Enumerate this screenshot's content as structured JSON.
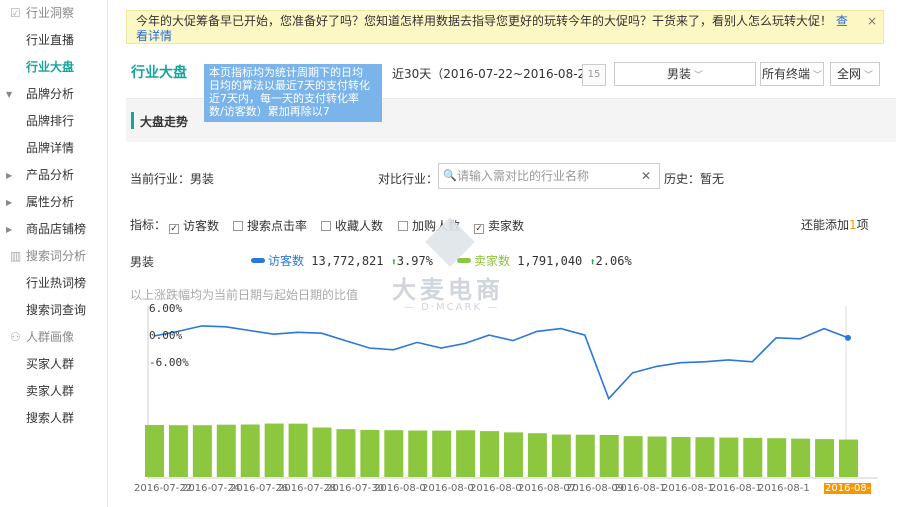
{
  "sidebar": {
    "groups": [
      {
        "icon": "☑",
        "label": "行业洞察",
        "items": [
          "行业直播",
          "行业大盘"
        ]
      },
      {
        "parents": [
          "品牌分析"
        ],
        "items": [
          "品牌排行",
          "品牌详情"
        ]
      },
      {
        "parents": [
          "产品分析",
          "属性分析",
          "商品店铺榜"
        ]
      },
      {
        "icon": "▥",
        "label": "搜索词分析",
        "items": [
          "行业热词榜",
          "搜索词查询"
        ]
      },
      {
        "icon": "⚇",
        "label": "人群画像",
        "items": [
          "买家人群",
          "卖家人群",
          "搜索人群"
        ]
      }
    ],
    "active": "行业大盘"
  },
  "notice": {
    "text": "今年的大促筹备早已开始，您准备好了吗？您知道怎样用数据去指导您更好的玩转今年的大促吗？干货来了，看别人怎么玩转大促！",
    "link": "查看详情",
    "close": "×"
  },
  "page_title": "行业大盘",
  "tooltip": "本页指标均为统计周期下的日均 日均的算法以最近7天的支付转化 近7天内，每一天的支付转化率 数/访客数）累加再除以7",
  "filters": {
    "range": "近30天（2016-07-22~2016-08-20）",
    "calendar_icon": "15",
    "industry": "男装",
    "terminal": "所有终端",
    "network": "全网"
  },
  "section_title": "大盘走势",
  "current_industry_label": "当前行业：",
  "current_industry": "男装",
  "compare_label": "对比行业：",
  "compare_placeholder": "请输入需对比的行业名称",
  "history_label": "历史：",
  "history_value": "暂无",
  "indicators_label": "指标：",
  "indicators": [
    {
      "label": "访客数",
      "checked": true
    },
    {
      "label": "搜索点击率",
      "checked": false
    },
    {
      "label": "收藏人数",
      "checked": false
    },
    {
      "label": "加购人数",
      "checked": false
    },
    {
      "label": "卖家数",
      "checked": true
    }
  ],
  "can_add": "还能添加",
  "can_add_count": "1",
  "can_add_unit": "项",
  "legend_row_label": "男装",
  "legend": [
    {
      "name": "访客数",
      "value": "13,772,821",
      "change": "3.97%",
      "color": "#2a78d8"
    },
    {
      "name": "卖家数",
      "value": "1,791,040",
      "change": "2.06%",
      "color": "#8dc63f"
    }
  ],
  "note": "以上涨跌幅均为当前日期与起始日期的比值",
  "watermark": {
    "cn": "大麦电商",
    "en": "— D·MCARK —"
  },
  "chart_data": {
    "type": "line",
    "y_ticks": [
      "6.00%",
      "0.00%",
      "-6.00%"
    ],
    "x": [
      "2016-07-22",
      "2016-07-23",
      "2016-07-24",
      "2016-07-25",
      "2016-07-26",
      "2016-07-27",
      "2016-07-28",
      "2016-07-29",
      "2016-07-30",
      "2016-07-31",
      "2016-08-01",
      "2016-08-02",
      "2016-08-03",
      "2016-08-04",
      "2016-08-05",
      "2016-08-06",
      "2016-08-07",
      "2016-08-08",
      "2016-08-09",
      "2016-08-10",
      "2016-08-11",
      "2016-08-12",
      "2016-08-13",
      "2016-08-14",
      "2016-08-15",
      "2016-08-16",
      "2016-08-17",
      "2016-08-18",
      "2016-08-19",
      "2016-08-20"
    ],
    "x_tick_labels": [
      "2016-07-22",
      "2016-07-24",
      "2016-07-26",
      "2016-07-28",
      "2016-07-30",
      "2016-08-01",
      "2016-08-03",
      "2016-08-05",
      "2016-08-07",
      "2016-08-09",
      "2016-08-11",
      "2016-08-13",
      "2016-08-15",
      "2016-08-17",
      "2016-08-20"
    ],
    "x_tick_shown": [
      "2016-07-22",
      "2016-07-24",
      "2016-07-26",
      "2016-07-28",
      "2016-07-30",
      "2016-08-0",
      "2016-08-0",
      "2016-08-0",
      "2016-08-07",
      "2016-08-09",
      "2016-08-1",
      "2016-08-1",
      "2016-08-1",
      "2016-08-1",
      "2016-08-"
    ],
    "series": [
      {
        "name": "访客数",
        "type": "line",
        "values": [
          0.0,
          1.0,
          2.2,
          2.0,
          1.2,
          0.4,
          0.8,
          0.6,
          -1.0,
          -2.6,
          -3.0,
          -1.4,
          -2.6,
          -1.6,
          0.2,
          -1.0,
          1.0,
          1.6,
          0.2,
          -13.6,
          -8.0,
          -6.6,
          -5.8,
          -5.6,
          -5.2,
          -5.6,
          -0.4,
          -0.6,
          1.6,
          -0.4
        ]
      },
      {
        "name": "卖家数",
        "type": "bar",
        "values": [
          100,
          99.6,
          99.6,
          100.6,
          101,
          102.8,
          102.6,
          95.2,
          92,
          90.4,
          90,
          89.4,
          89.2,
          89.8,
          88.2,
          85.8,
          84.2,
          81.6,
          81.4,
          80.8,
          78.6,
          77.8,
          77,
          76.6,
          75.8,
          75.2,
          74.6,
          73.8,
          72.8,
          72
        ]
      }
    ]
  }
}
